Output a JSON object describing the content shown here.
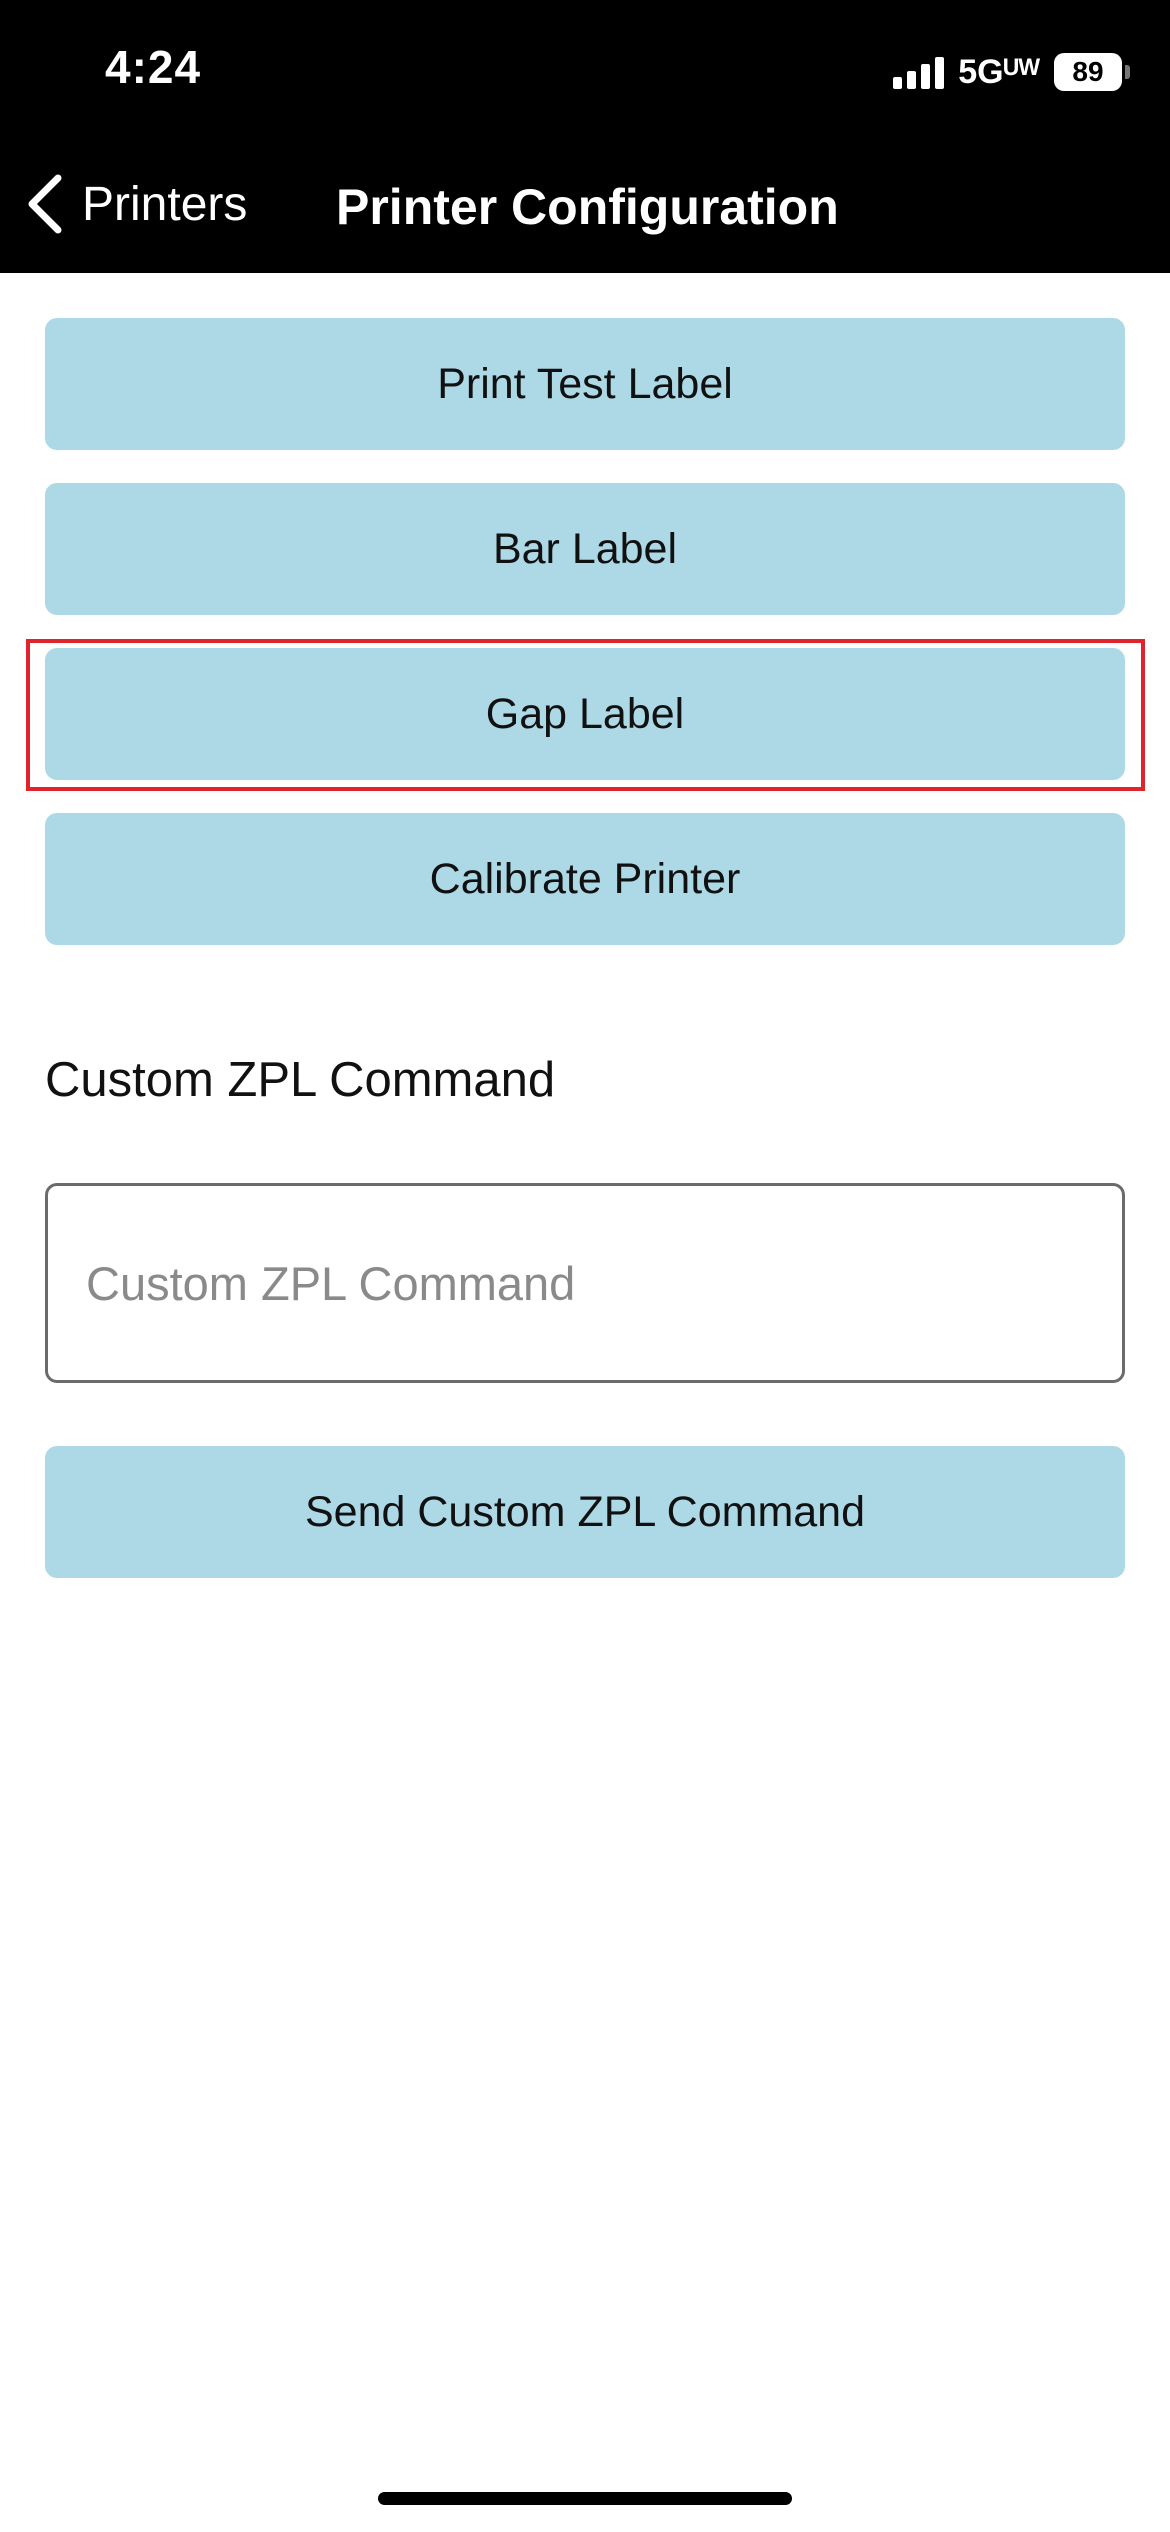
{
  "status_bar": {
    "time": "4:24",
    "network": "5Gᵁᵂ",
    "battery": "89"
  },
  "nav": {
    "back_label": "Printers",
    "title": "Printer Configuration"
  },
  "actions": {
    "print_test_label": "Print Test Label",
    "bar_label": "Bar Label",
    "gap_label": "Gap Label",
    "calibrate_printer": "Calibrate Printer"
  },
  "custom_zpl": {
    "section_label": "Custom ZPL Command",
    "input_value": "",
    "input_placeholder": "Custom ZPL Command",
    "send_button": "Send Custom ZPL Command"
  },
  "icons": {
    "back": "chevron-left-icon",
    "signal": "cellular-signal-icon",
    "battery": "battery-icon"
  },
  "colors": {
    "button_bg": "#add8e6",
    "highlight": "#e0242c",
    "header_bg": "#000000"
  }
}
